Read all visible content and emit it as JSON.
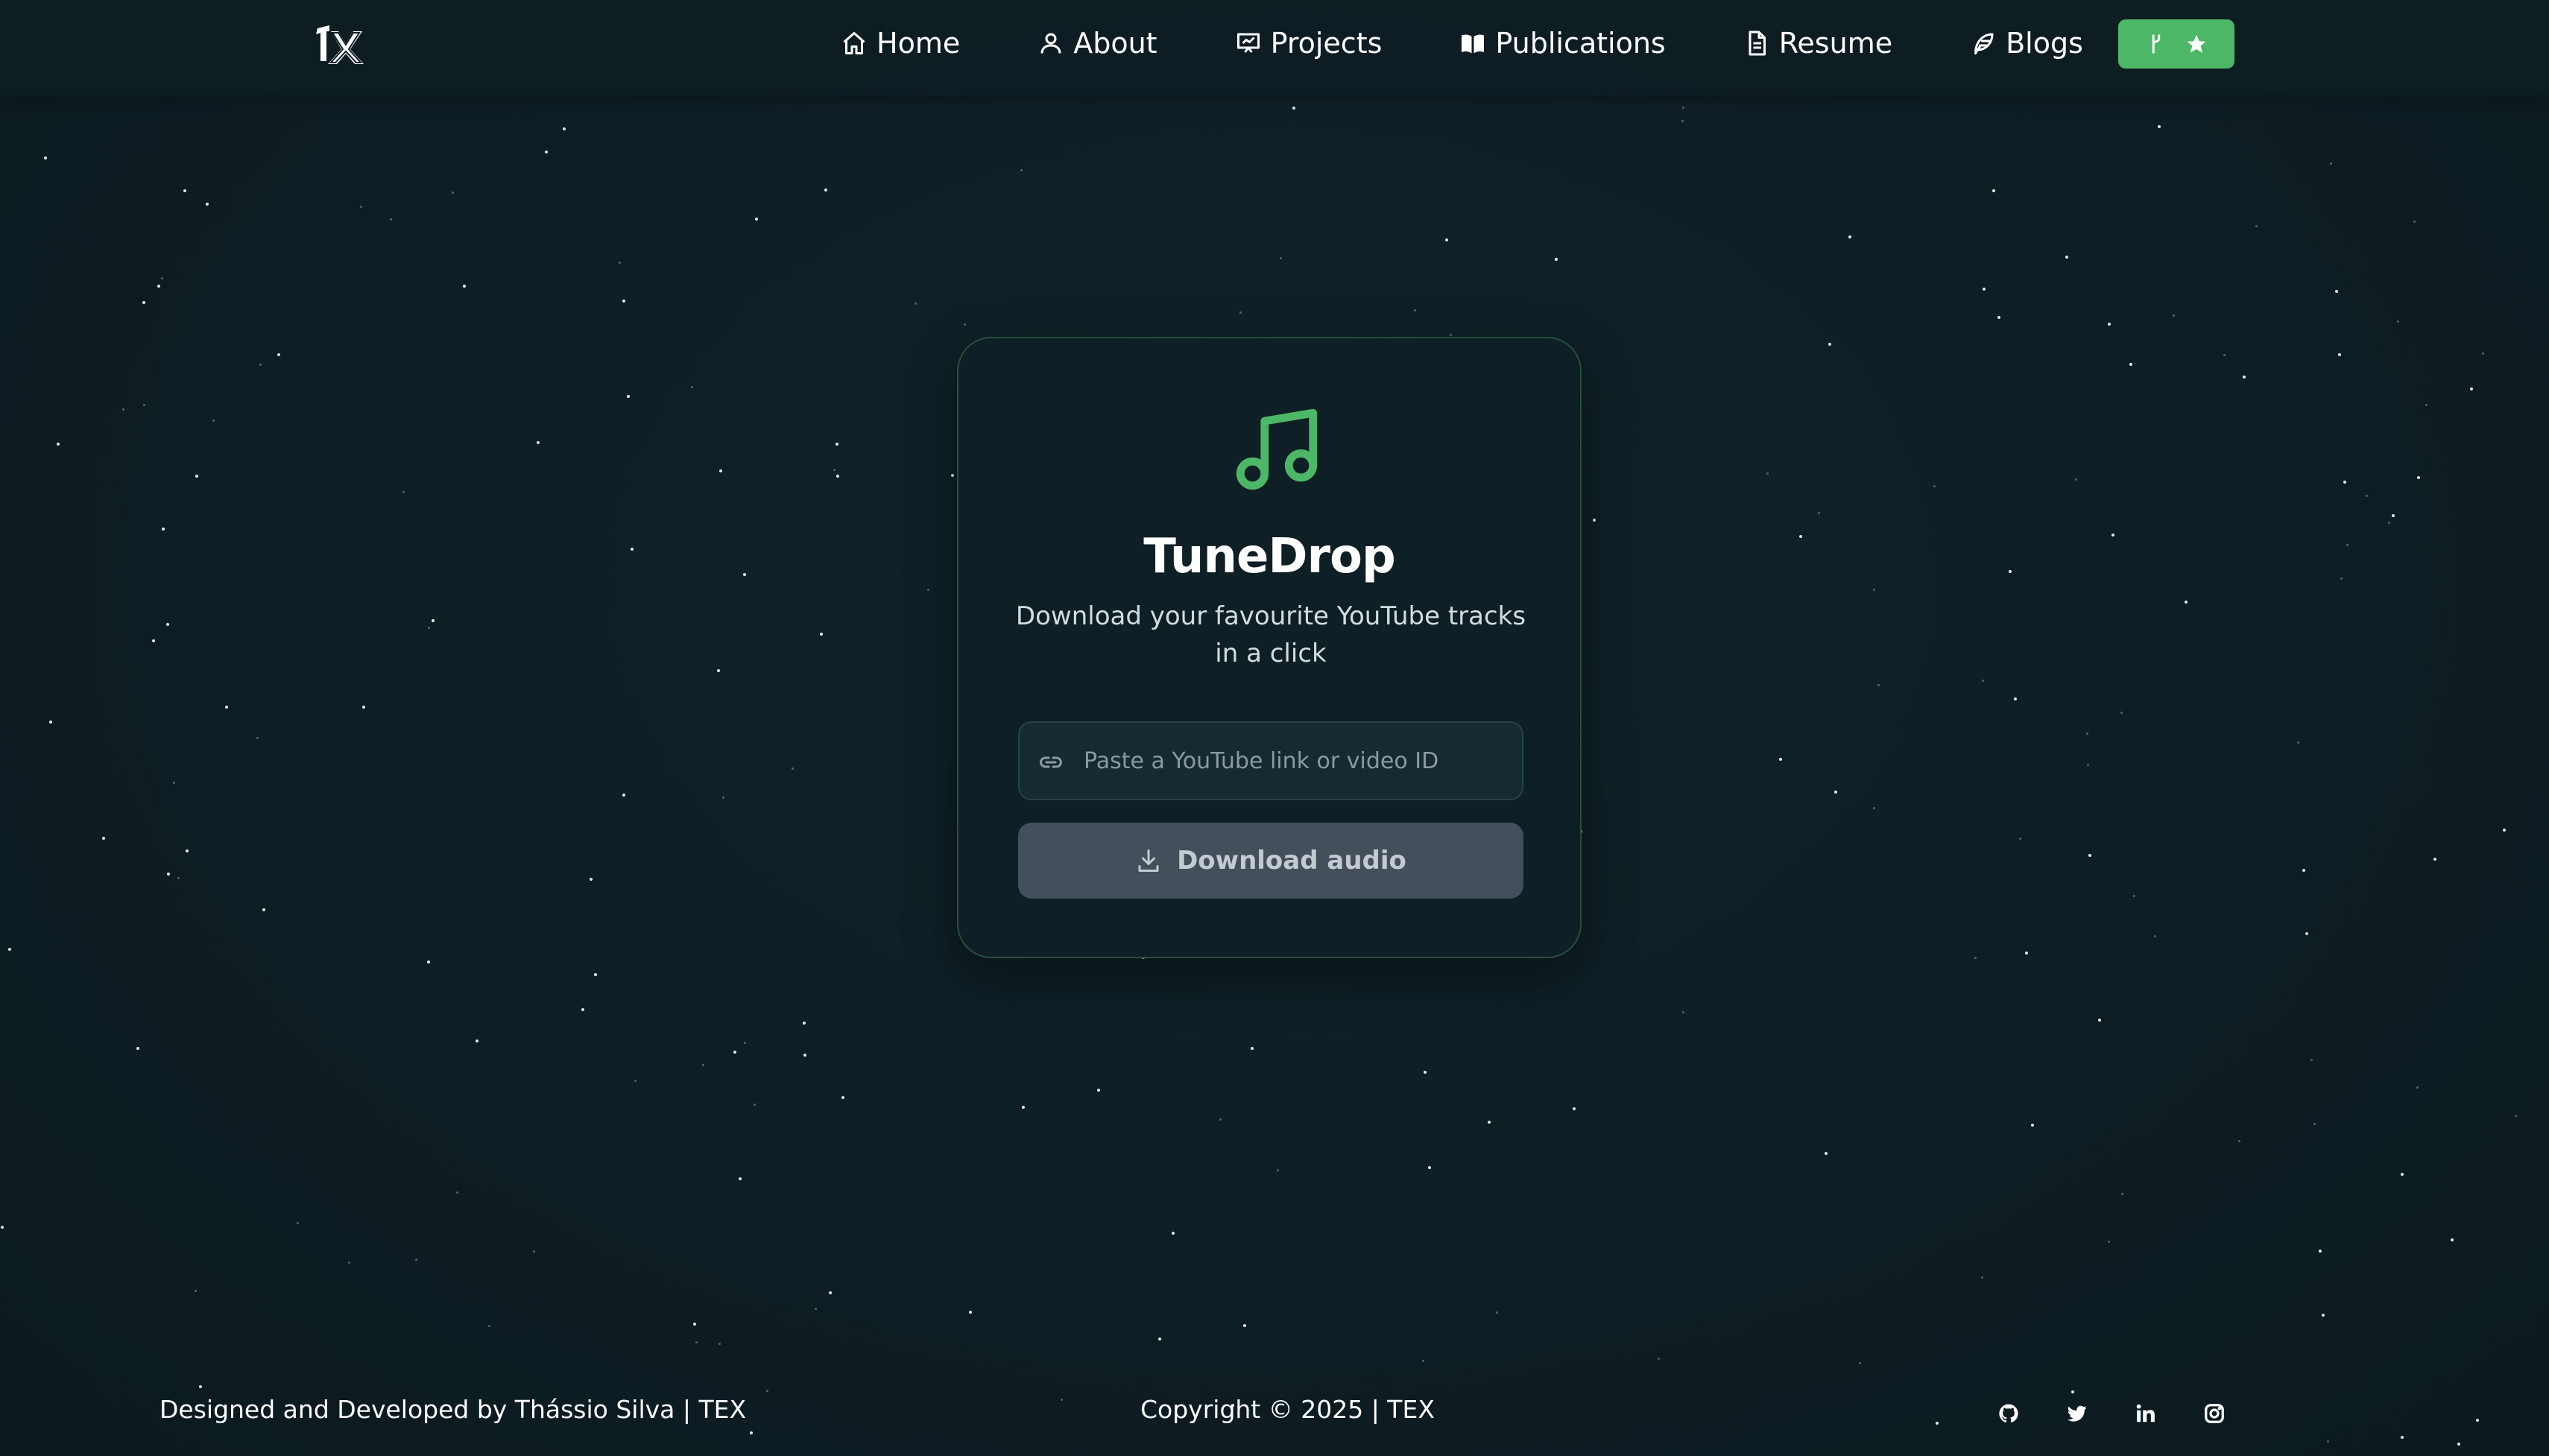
{
  "nav": {
    "logo_icon": "tx-logo",
    "items": [
      {
        "label": "Home",
        "icon": "home-icon"
      },
      {
        "label": "About",
        "icon": "user-icon"
      },
      {
        "label": "Projects",
        "icon": "presentation-icon"
      },
      {
        "label": "Publications",
        "icon": "book-open-icon"
      },
      {
        "label": "Resume",
        "icon": "document-icon"
      },
      {
        "label": "Blogs",
        "icon": "feather-icon"
      }
    ],
    "github_button": {
      "icons": [
        "git-fork-icon",
        "star-icon"
      ]
    }
  },
  "card": {
    "icon": "music-note-icon",
    "title": "TuneDrop",
    "subtitle": "Download your favourite YouTube tracks in a click",
    "input": {
      "placeholder": "Paste a YouTube link or video ID",
      "value": "",
      "icon": "link-icon"
    },
    "button": {
      "label": "Download audio",
      "icon": "download-icon"
    }
  },
  "footer": {
    "credit": "Designed and Developed by Thássio Silva | TEX",
    "copyright": "Copyright © 2025 | TEX",
    "socials": [
      "github-icon",
      "twitter-icon",
      "linkedin-icon",
      "instagram-icon"
    ]
  },
  "colors": {
    "background": "#0f1e24",
    "accent": "#4cb766",
    "card_border": "#27503a",
    "button_disabled": "#434f5b"
  }
}
